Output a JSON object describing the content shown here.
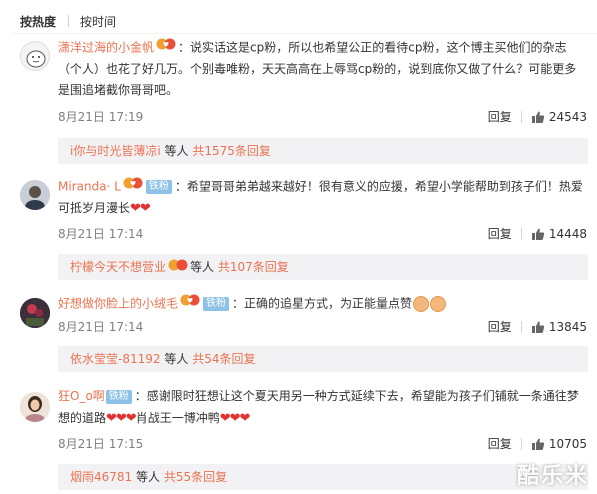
{
  "tabs": [
    {
      "label": "按热度",
      "active": true
    },
    {
      "label": "按时间",
      "active": false
    }
  ],
  "comments": [
    {
      "username": "潇洋过海的小金帆",
      "tag": "",
      "text": "：说实话这是cp粉，所以也希望公正的看待cp粉，这个博主买他们的杂志（个人）也花了好几万。个别毒唯粉，天天高高在上辱骂cp粉的，说到底你又做了什么？可能更多是围追堵截你哥哥吧。",
      "hearts": "",
      "time": "8月21日 17:19",
      "reply_label": "回复",
      "likes": "24543",
      "sub": {
        "name": "i你与时光皆薄凉i",
        "etc": "等人",
        "count": "共1575条回复"
      }
    },
    {
      "username": "Miranda· L",
      "tag": "铁粉",
      "text": "：希望哥哥弟弟越来越好！很有意义的应援，希望小学能帮助到孩子们！热爱可抵岁月漫长",
      "hearts": "❤❤",
      "time": "8月21日 17:14",
      "reply_label": "回复",
      "likes": "14448",
      "sub": {
        "name": "柠檬今天不想营业",
        "etc": "等人",
        "count": "共107条回复"
      }
    },
    {
      "username": "好想做你脸上的小绒毛",
      "tag": "铁粉",
      "text": "：正确的追星方式，为正能量点赞",
      "hearts": "",
      "time": "8月21日 17:14",
      "reply_label": "回复",
      "likes": "13845",
      "sub": {
        "name": "依水莹莹-81192",
        "etc": "等人",
        "count": "共54条回复"
      }
    },
    {
      "username": "狂O_o啊",
      "tag": "铁粉",
      "text": "：感谢限时狂想让这个夏天用另一种方式延续下去，希望能为孩子们铺就一条通往梦想的道路",
      "hearts": "❤❤❤",
      "text2": "肖战王一博冲鸭",
      "hearts2": "❤❤❤",
      "time": "8月21日 17:15",
      "reply_label": "回复",
      "likes": "10705",
      "sub": {
        "name": "烟雨46781",
        "etc": "等人",
        "count": "共55条回复"
      }
    }
  ],
  "watermark": "酷乐米",
  "colors": {
    "username": "#eb7350",
    "tag_bg": "#8cc1e8",
    "sub_bg": "#f2f2f5",
    "heart": "#e23333"
  }
}
